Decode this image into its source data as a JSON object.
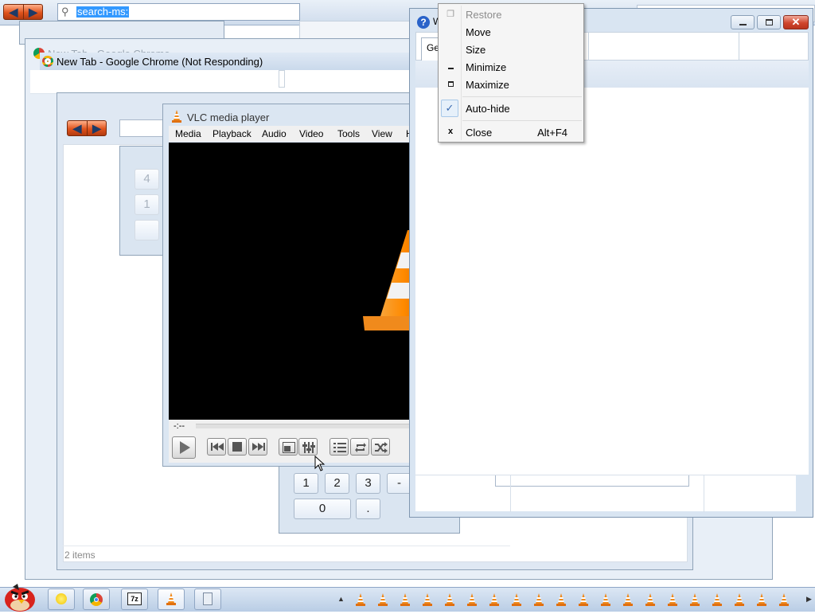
{
  "address_bar": {
    "value": "search-ms:"
  },
  "chrome_window": {
    "title_back": "New Tab - Google Chrome",
    "title_front": "New Tab - Google Chrome (Not Responding)"
  },
  "explorer": {
    "status": "2 items"
  },
  "calculator": {
    "keys_top": [
      "4",
      "1"
    ],
    "keys_bottom": [
      "1",
      "2",
      "3",
      "-",
      "0",
      "."
    ]
  },
  "vlc": {
    "title": "VLC media player",
    "menu": [
      "Media",
      "Playback",
      "Audio",
      "Video",
      "Tools",
      "View",
      "H"
    ],
    "time": "-:--"
  },
  "right_window": {
    "tab_label": "Ge"
  },
  "context_menu": {
    "items": [
      {
        "label": "Restore",
        "icon": "restore-icon",
        "disabled": true,
        "accel": ""
      },
      {
        "label": "Move",
        "icon": "",
        "disabled": false,
        "accel": ""
      },
      {
        "label": "Size",
        "icon": "",
        "disabled": false,
        "accel": ""
      },
      {
        "label": "Minimize",
        "icon": "minimize-icon",
        "disabled": false,
        "accel": ""
      },
      {
        "label": "Maximize",
        "icon": "maximize-icon",
        "disabled": false,
        "accel": ""
      },
      {
        "label": "Auto-hide",
        "icon": "check-icon",
        "disabled": false,
        "accel": ""
      },
      {
        "label": "Close",
        "icon": "close-icon",
        "disabled": false,
        "accel": "Alt+F4"
      }
    ]
  },
  "colors": {
    "accent_orange": "#f08a1c",
    "title_blue": "#dde8f3",
    "selection": "#3399ff"
  }
}
